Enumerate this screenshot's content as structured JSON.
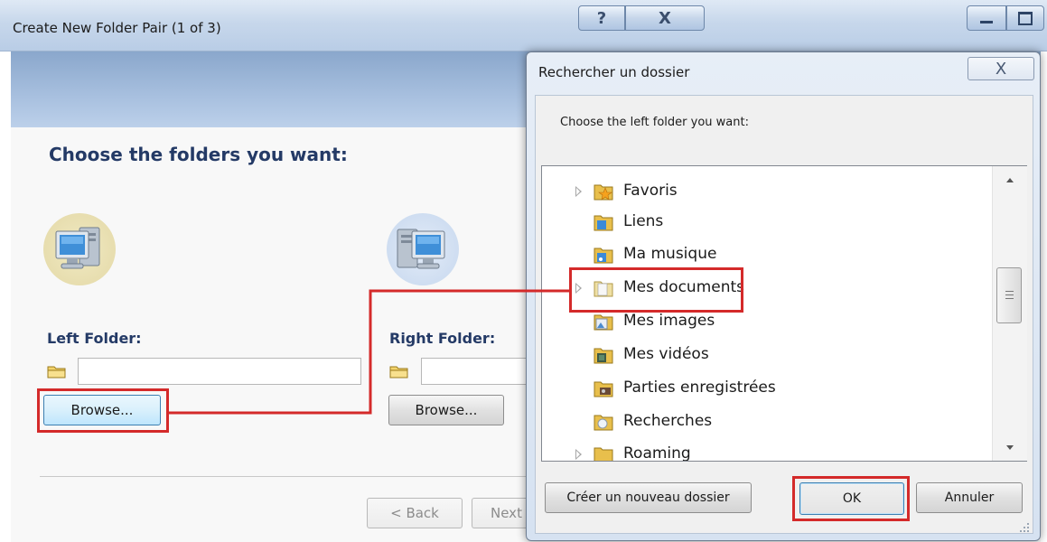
{
  "window": {
    "title": "Create New Folder Pair (1 of 3)",
    "help_glyph": "?",
    "close_glyph": "X"
  },
  "wizard": {
    "heading": "Choose the folders you want:",
    "left_label": "Left Folder:",
    "right_label": "Right Folder:",
    "left_path": "",
    "right_path": "",
    "browse_label": "Browse...",
    "back_label": "< Back",
    "next_label": "Next"
  },
  "dialog": {
    "title": "Rechercher un dossier",
    "close_glyph": "X",
    "prompt": "Choose the left folder you want:",
    "tree": [
      {
        "label": "Favoris",
        "icon": "favorites-folder-icon",
        "expandable": true
      },
      {
        "label": "Liens",
        "icon": "links-folder-icon",
        "expandable": false
      },
      {
        "label": "Ma musique",
        "icon": "music-folder-icon",
        "expandable": false
      },
      {
        "label": "Mes documents",
        "icon": "documents-folder-icon",
        "expandable": true
      },
      {
        "label": "Mes images",
        "icon": "pictures-folder-icon",
        "expandable": false
      },
      {
        "label": "Mes vidéos",
        "icon": "videos-folder-icon",
        "expandable": false
      },
      {
        "label": "Parties enregistrées",
        "icon": "saved-games-folder-icon",
        "expandable": false
      },
      {
        "label": "Recherches",
        "icon": "searches-folder-icon",
        "expandable": false
      },
      {
        "label": "Roaming",
        "icon": "folder-icon",
        "expandable": true
      }
    ],
    "new_folder_label": "Créer un nouveau dossier",
    "ok_label": "OK",
    "cancel_label": "Annuler"
  },
  "colors": {
    "highlight": "#d42a2a",
    "heading": "#243a66"
  }
}
